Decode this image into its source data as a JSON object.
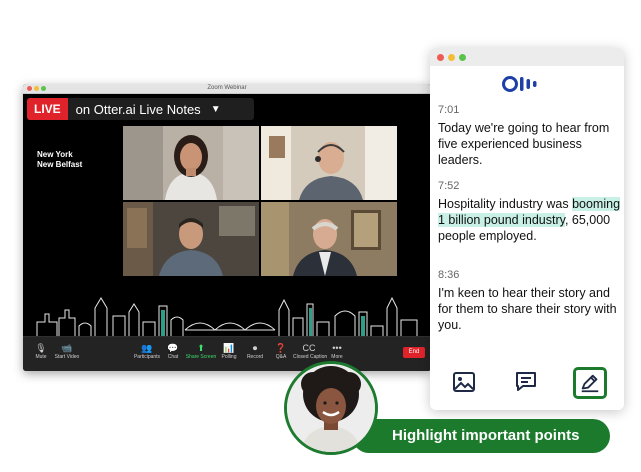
{
  "zoom": {
    "window_title": "Zoom Webinar",
    "live": {
      "badge": "LIVE",
      "title": "on Otter.ai Live Notes",
      "caret": "▼"
    },
    "city_lines": [
      "New York",
      "New Belfast"
    ],
    "toolbar": [
      {
        "icon": "mic-icon",
        "glyph": "🎙",
        "label": "Mute"
      },
      {
        "icon": "video-icon",
        "glyph": "📹",
        "label": "Start Video"
      },
      {
        "icon": "participants-icon",
        "glyph": "👥",
        "label": "Participants"
      },
      {
        "icon": "chat-icon",
        "glyph": "💬",
        "label": "Chat"
      },
      {
        "icon": "share-screen-icon",
        "glyph": "⬆",
        "label": "Share Screen"
      },
      {
        "icon": "polling-icon",
        "glyph": "📊",
        "label": "Polling"
      },
      {
        "icon": "record-icon",
        "glyph": "⏺",
        "label": "Record"
      },
      {
        "icon": "qa-icon",
        "glyph": "❓",
        "label": "Q&A"
      },
      {
        "icon": "closed-caption-icon",
        "glyph": "CC",
        "label": "Closed Caption"
      },
      {
        "icon": "more-icon",
        "glyph": "•••",
        "label": "More"
      }
    ],
    "end_label": "End"
  },
  "otter": {
    "entries": [
      {
        "time": "7:01",
        "text_before": "Today we're going to hear from five experienced business leaders.",
        "highlight": "",
        "text_after": ""
      },
      {
        "time": "7:52",
        "text_before": "Hospitality industry was ",
        "highlight": "booming 1 billion pound industry",
        "text_after": ", 65,000 people employed."
      },
      {
        "time": "8:36",
        "text_before": "I'm keen to hear their story and for them to share their story with you.",
        "highlight": "",
        "text_after": ""
      }
    ],
    "bottom_icons": [
      "image-icon",
      "comment-icon",
      "highlight-pen-icon"
    ]
  },
  "callout": {
    "label": "Highlight important points"
  },
  "colors": {
    "accent_green": "#1b7a2b",
    "highlight_mint": "#c9f0e6",
    "otter_blue": "#1f3fa8",
    "live_red": "#e0232b"
  }
}
